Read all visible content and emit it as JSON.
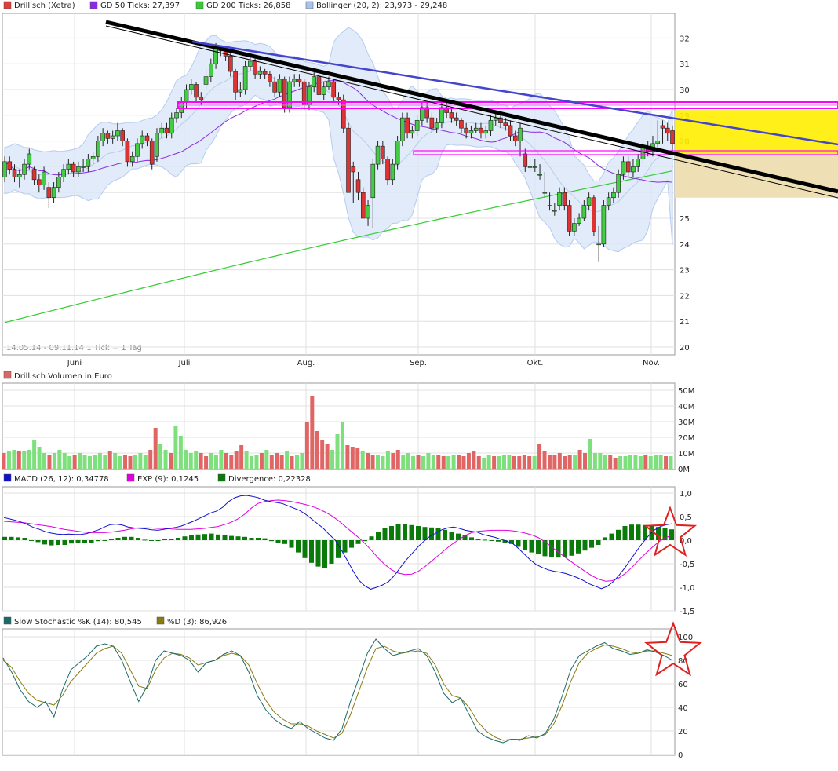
{
  "legend_top": [
    {
      "label": "Drillisch (Xetra)",
      "color": "#e03c3c"
    },
    {
      "label": "GD 50 Ticks: 27,397",
      "color": "#8a2be2"
    },
    {
      "label": "GD 200 Ticks: 26,858",
      "color": "#33cc33"
    },
    {
      "label": "Bollinger (20, 2): 23,973 - 29,248",
      "color": "#a8c4ee"
    }
  ],
  "legend_volume": {
    "label": "Drillisch Volumen in Euro",
    "color": "#e06666"
  },
  "legend_macd": [
    {
      "label": "MACD (26, 12): 0,34778",
      "color": "#1010cc"
    },
    {
      "label": "EXP (9): 0,1245",
      "color": "#e000e0"
    },
    {
      "label": "Divergence: 0,22328",
      "color": "#0a7a0a"
    }
  ],
  "legend_stoch": [
    {
      "label": "Slow Stochastic %K (14): 80,545",
      "color": "#1a6a6a"
    },
    {
      "label": "%D (3): 86,926",
      "color": "#8a7a10"
    }
  ],
  "period_note": "14.05.14 - 09.11.14   1 Tick = 1 Tag",
  "chart_data": [
    {
      "type": "candlestick",
      "title": "Drillisch (Xetra)",
      "x_labels": [
        "Juni",
        "Juli",
        "Aug.",
        "Sep.",
        "Okt.",
        "Nov."
      ],
      "y_ticks": [
        "32",
        "31",
        "30",
        "29",
        "28",
        "27",
        "26",
        "25",
        "24",
        "23",
        "22",
        "21",
        "20"
      ],
      "ylim": [
        19.8,
        32.8
      ],
      "close": [
        27.2,
        26.9,
        26.6,
        26.7,
        27.1,
        27.5,
        26.5,
        26.3,
        26.8,
        25.8,
        26.2,
        26.6,
        26.9,
        27.1,
        26.8,
        27.0,
        27.0,
        27.3,
        27.4,
        28.0,
        28.3,
        28.1,
        28.2,
        28.4,
        28.0,
        27.2,
        27.4,
        27.9,
        28.2,
        28.0,
        27.1,
        28.3,
        28.5,
        28.3,
        28.9,
        29.1,
        29.5,
        30.0,
        30.2,
        29.7,
        29.6,
        30.5,
        31.0,
        31.6,
        31.5,
        31.3,
        30.7,
        29.9,
        30.0,
        30.9,
        31.1,
        30.6,
        30.7,
        30.6,
        30.3,
        29.9,
        30.4,
        29.3,
        30.3,
        30.4,
        30.3,
        29.4,
        30.1,
        30.5,
        29.8,
        30.1,
        30.3,
        29.7,
        29.6,
        28.5,
        26.0,
        26.8,
        26.0,
        25.0,
        25.5,
        27.1,
        27.8,
        27.3,
        26.5,
        27.1,
        28.0,
        28.9,
        28.3,
        28.4,
        28.8,
        29.3,
        28.9,
        28.5,
        28.7,
        29.3,
        29.1,
        28.9,
        28.8,
        28.5,
        28.3,
        28.4,
        28.5,
        28.3,
        28.4,
        28.8,
        28.9,
        28.7,
        28.6,
        28.2,
        28.0,
        28.5,
        27.0,
        27.0,
        27.0,
        26.7,
        26.0,
        25.5,
        25.3,
        26.0,
        25.5,
        24.5,
        24.8,
        25.0,
        25.5,
        25.8,
        24.5,
        24.0,
        25.5,
        25.8,
        26.0,
        26.7,
        27.2,
        26.8,
        27.0,
        27.3,
        27.8,
        27.6,
        27.9,
        28.0,
        28.5,
        28.3,
        27.9
      ],
      "open": [
        26.6,
        27.2,
        26.9,
        26.6,
        26.7,
        27.1,
        26.9,
        26.5,
        26.3,
        26.2,
        25.8,
        26.2,
        26.6,
        26.9,
        27.1,
        26.8,
        27.0,
        27.0,
        27.3,
        27.4,
        28.0,
        28.3,
        28.1,
        28.2,
        28.4,
        28.0,
        27.2,
        27.4,
        27.9,
        28.2,
        28.0,
        27.4,
        28.3,
        28.5,
        28.3,
        28.9,
        29.1,
        29.5,
        30.0,
        30.2,
        29.7,
        30.2,
        30.5,
        31.0,
        31.6,
        31.5,
        31.3,
        30.7,
        29.9,
        30.0,
        30.9,
        31.1,
        30.6,
        30.7,
        30.6,
        30.3,
        29.9,
        30.4,
        29.3,
        30.3,
        30.4,
        30.3,
        29.4,
        30.1,
        30.5,
        29.8,
        30.1,
        30.3,
        29.7,
        29.6,
        28.5,
        27.0,
        26.5,
        26.0,
        25.0,
        25.8,
        27.1,
        27.8,
        27.3,
        26.5,
        27.1,
        28.0,
        28.9,
        28.3,
        28.4,
        28.8,
        29.3,
        28.9,
        28.5,
        28.7,
        29.3,
        29.1,
        28.9,
        28.8,
        28.5,
        28.3,
        28.4,
        28.5,
        28.3,
        28.4,
        28.8,
        28.9,
        28.7,
        28.6,
        28.2,
        28.0,
        27.5,
        27.0,
        27.0,
        26.7,
        26.0,
        25.5,
        25.3,
        25.5,
        26.0,
        25.5,
        24.5,
        24.8,
        25.0,
        25.5,
        25.8,
        24.0,
        24.0,
        25.5,
        25.8,
        26.0,
        26.7,
        27.2,
        26.8,
        27.0,
        27.3,
        27.8,
        27.6,
        27.9,
        28.6,
        28.5,
        28.4
      ],
      "high": [
        27.4,
        27.4,
        27.1,
        26.9,
        27.3,
        27.7,
        27.0,
        26.7,
        27.0,
        26.4,
        26.4,
        26.8,
        27.1,
        27.3,
        27.2,
        27.2,
        27.3,
        27.5,
        27.6,
        28.2,
        28.5,
        28.4,
        28.4,
        28.7,
        28.5,
        28.1,
        27.6,
        28.1,
        28.4,
        28.3,
        28.1,
        28.5,
        28.7,
        28.7,
        29.1,
        29.3,
        29.7,
        30.2,
        30.4,
        30.3,
        29.9,
        30.8,
        31.2,
        31.8,
        31.7,
        31.6,
        31.4,
        30.8,
        30.3,
        31.1,
        31.3,
        31.2,
        30.9,
        30.8,
        30.7,
        30.5,
        30.6,
        30.5,
        30.5,
        30.6,
        30.6,
        30.4,
        30.3,
        30.7,
        30.6,
        30.3,
        30.5,
        30.4,
        29.9,
        29.8,
        28.7,
        27.2,
        26.8,
        26.2,
        25.7,
        27.3,
        28.0,
        28.0,
        27.4,
        27.3,
        28.2,
        29.1,
        29.1,
        28.6,
        29.0,
        29.5,
        29.5,
        29.1,
        28.9,
        29.5,
        29.5,
        29.3,
        29.1,
        28.9,
        28.7,
        28.6,
        28.7,
        28.7,
        28.6,
        29.0,
        29.1,
        29.0,
        28.9,
        28.8,
        28.4,
        28.7,
        27.7,
        27.3,
        27.3,
        27.1,
        26.8,
        26.0,
        25.6,
        26.2,
        26.2,
        25.7,
        25.0,
        25.2,
        25.7,
        26.0,
        25.9,
        24.7,
        25.7,
        26.0,
        26.2,
        26.9,
        27.4,
        27.4,
        27.3,
        27.5,
        28.0,
        28.0,
        28.2,
        28.8,
        28.8,
        28.7,
        28.6
      ],
      "low": [
        26.4,
        26.7,
        26.4,
        26.2,
        26.5,
        26.9,
        26.3,
        26.0,
        26.1,
        25.4,
        25.6,
        26.0,
        26.4,
        26.7,
        26.6,
        26.6,
        26.8,
        26.8,
        27.1,
        27.2,
        27.8,
        27.9,
        27.9,
        28.0,
        27.8,
        27.0,
        27.0,
        27.2,
        27.7,
        27.8,
        26.9,
        27.2,
        28.1,
        28.1,
        28.1,
        28.7,
        28.9,
        29.3,
        29.8,
        29.5,
        29.4,
        30.0,
        30.3,
        30.8,
        31.3,
        31.1,
        30.5,
        29.6,
        29.7,
        29.8,
        30.7,
        30.4,
        30.4,
        30.4,
        30.1,
        29.7,
        29.7,
        29.1,
        29.1,
        30.1,
        30.1,
        29.2,
        29.2,
        29.9,
        29.6,
        29.6,
        30.0,
        29.5,
        29.4,
        28.3,
        27.5,
        25.6,
        25.7,
        25.6,
        24.7,
        24.6,
        26.9,
        27.1,
        26.3,
        26.3,
        26.9,
        27.8,
        28.1,
        28.1,
        28.2,
        28.6,
        28.7,
        28.3,
        28.3,
        28.5,
        28.9,
        28.7,
        28.6,
        28.3,
        28.1,
        28.1,
        28.3,
        28.1,
        28.1,
        28.2,
        28.6,
        28.5,
        28.4,
        28.0,
        27.8,
        27.4,
        26.8,
        26.8,
        26.8,
        26.5,
        25.8,
        25.3,
        25.1,
        25.3,
        25.3,
        24.3,
        24.3,
        24.7,
        24.9,
        25.3,
        24.3,
        23.3,
        23.9,
        25.3,
        25.6,
        25.8,
        26.5,
        26.6,
        26.6,
        26.8,
        27.1,
        27.4,
        27.4,
        27.7,
        27.9,
        28.0,
        27.6
      ],
      "bollinger": {
        "upper_last": 29.248,
        "lower_last": 23.973
      }
    },
    {
      "type": "bar",
      "title": "Drillisch Volumen in Euro",
      "y_ticks": [
        "50M",
        "40M",
        "30M",
        "20M",
        "10M",
        "0M"
      ],
      "ylim": [
        0,
        50
      ],
      "values": [
        10,
        11,
        12,
        11,
        11,
        12,
        18,
        14,
        10,
        9,
        10,
        12,
        10,
        8,
        9,
        10,
        9,
        8,
        9,
        10,
        9,
        11,
        10,
        8,
        9,
        8,
        9,
        10,
        9,
        12,
        26,
        16,
        12,
        10,
        27,
        21,
        12,
        10,
        11,
        10,
        8,
        10,
        9,
        12,
        10,
        9,
        11,
        15,
        11,
        8,
        9,
        10,
        12,
        9,
        10,
        9,
        11,
        8,
        9,
        10,
        30,
        46,
        24,
        18,
        16,
        12,
        22,
        30,
        15,
        14,
        13,
        11,
        10,
        9,
        9,
        8,
        11,
        10,
        12,
        9,
        10,
        8,
        9,
        8,
        10,
        9,
        9,
        8,
        8,
        9,
        9,
        8,
        10,
        11,
        8,
        7,
        9,
        8,
        8,
        9,
        9,
        8,
        8,
        9,
        8,
        8,
        16,
        11,
        9,
        9,
        10,
        8,
        9,
        9,
        12,
        10,
        19,
        10,
        10,
        9,
        9,
        7,
        8,
        8,
        9,
        9,
        8,
        9,
        8,
        9,
        9,
        8,
        8
      ],
      "up": [
        0,
        1,
        1,
        0,
        1,
        1,
        1,
        1,
        1,
        0,
        1,
        1,
        1,
        1,
        0,
        1,
        1,
        1,
        1,
        1,
        1,
        0,
        1,
        1,
        0,
        0,
        1,
        1,
        1,
        0,
        0,
        1,
        1,
        0,
        1,
        1,
        1,
        1,
        1,
        0,
        0,
        1,
        1,
        1,
        0,
        0,
        0,
        0,
        1,
        1,
        1,
        0,
        1,
        0,
        0,
        0,
        1,
        0,
        1,
        1,
        0,
        0,
        0,
        0,
        0,
        1,
        1,
        1,
        0,
        0,
        0,
        1,
        0,
        0,
        1,
        1,
        1,
        0,
        0,
        1,
        1,
        1,
        0,
        1,
        1,
        1,
        0,
        0,
        1,
        1,
        0,
        0,
        0,
        0,
        0,
        1,
        1,
        0,
        1,
        1,
        1,
        0,
        0,
        0,
        0,
        1,
        0,
        0,
        0,
        0,
        0,
        0,
        0,
        1,
        0,
        0,
        1,
        1,
        1,
        1,
        0,
        0,
        1,
        1,
        1,
        1,
        1,
        0,
        1,
        1,
        1,
        0,
        1
      ]
    },
    {
      "type": "line",
      "title": "MACD (26, 12)",
      "y_ticks": [
        "1,0",
        "0,5",
        "0,0",
        "-0,5",
        "-1,0",
        "-1,5"
      ],
      "ylim": [
        -1.5,
        1.0
      ],
      "macd": [
        0.48,
        0.45,
        0.42,
        0.38,
        0.33,
        0.27,
        0.23,
        0.18,
        0.15,
        0.13,
        0.12,
        0.13,
        0.12,
        0.12,
        0.14,
        0.18,
        0.22,
        0.28,
        0.33,
        0.34,
        0.32,
        0.28,
        0.26,
        0.25,
        0.24,
        0.22,
        0.21,
        0.23,
        0.25,
        0.27,
        0.3,
        0.35,
        0.4,
        0.46,
        0.52,
        0.58,
        0.62,
        0.7,
        0.82,
        0.9,
        0.94,
        0.95,
        0.93,
        0.9,
        0.85,
        0.82,
        0.8,
        0.78,
        0.73,
        0.68,
        0.63,
        0.55,
        0.45,
        0.35,
        0.25,
        0.12,
        0.0,
        -0.2,
        -0.42,
        -0.65,
        -0.85,
        -0.97,
        -1.04,
        -1.0,
        -0.95,
        -0.88,
        -0.75,
        -0.58,
        -0.42,
        -0.28,
        -0.14,
        -0.02,
        0.08,
        0.15,
        0.22,
        0.26,
        0.28,
        0.25,
        0.21,
        0.19,
        0.17,
        0.12,
        0.09,
        0.06,
        0.02,
        -0.02,
        -0.07,
        -0.18,
        -0.3,
        -0.42,
        -0.52,
        -0.58,
        -0.63,
        -0.66,
        -0.68,
        -0.71,
        -0.75,
        -0.8,
        -0.86,
        -0.93,
        -0.98,
        -1.03,
        -0.98,
        -0.88,
        -0.74,
        -0.58,
        -0.4,
        -0.22,
        -0.05,
        0.1,
        0.22,
        0.29,
        0.33,
        0.35
      ],
      "signal": [
        0.4,
        0.39,
        0.38,
        0.37,
        0.35,
        0.33,
        0.31,
        0.29,
        0.26,
        0.23,
        0.21,
        0.19,
        0.17,
        0.16,
        0.16,
        0.16,
        0.17,
        0.19,
        0.21,
        0.24,
        0.26,
        0.26,
        0.26,
        0.25,
        0.25,
        0.24,
        0.23,
        0.23,
        0.23,
        0.24,
        0.25,
        0.27,
        0.29,
        0.33,
        0.38,
        0.45,
        0.55,
        0.68,
        0.78,
        0.82,
        0.84,
        0.85,
        0.84,
        0.82,
        0.79,
        0.76,
        0.72,
        0.67,
        0.6,
        0.52,
        0.42,
        0.3,
        0.18,
        0.06,
        -0.07,
        -0.22,
        -0.38,
        -0.52,
        -0.63,
        -0.7,
        -0.73,
        -0.72,
        -0.66,
        -0.56,
        -0.44,
        -0.32,
        -0.2,
        -0.09,
        0.01,
        0.1,
        0.16,
        0.19,
        0.2,
        0.21,
        0.21,
        0.21,
        0.2,
        0.18,
        0.15,
        0.11,
        0.05,
        -0.04,
        -0.15,
        -0.26,
        -0.37,
        -0.47,
        -0.57,
        -0.67,
        -0.76,
        -0.83,
        -0.87,
        -0.86,
        -0.8,
        -0.7,
        -0.57,
        -0.42,
        -0.28,
        -0.15,
        -0.03,
        0.05,
        0.12
      ],
      "divergence": [
        0.07,
        0.07,
        0.06,
        0.05,
        0.0,
        -0.04,
        -0.09,
        -0.11,
        -0.1,
        -0.1,
        -0.07,
        -0.06,
        -0.06,
        -0.05,
        -0.02,
        0.0,
        0.02,
        0.05,
        0.07,
        0.07,
        0.05,
        0.01,
        -0.01,
        0.0,
        0.02,
        0.03,
        0.05,
        0.08,
        0.1,
        0.12,
        0.13,
        0.14,
        0.12,
        0.1,
        0.09,
        0.08,
        0.07,
        0.05,
        0.05,
        0.04,
        -0.02,
        -0.05,
        -0.08,
        -0.16,
        -0.26,
        -0.38,
        -0.48,
        -0.56,
        -0.6,
        -0.5,
        -0.38,
        -0.26,
        -0.16,
        -0.08,
        -0.02,
        0.08,
        0.18,
        0.26,
        0.3,
        0.34,
        0.34,
        0.32,
        0.3,
        0.28,
        0.27,
        0.25,
        0.22,
        0.18,
        0.14,
        0.1,
        0.06,
        0.03,
        0.01,
        0.0,
        -0.03,
        -0.05,
        -0.08,
        -0.14,
        -0.2,
        -0.26,
        -0.3,
        -0.34,
        -0.36,
        -0.37,
        -0.36,
        -0.33,
        -0.28,
        -0.22,
        -0.16,
        -0.1,
        0.06,
        0.14,
        0.22,
        0.3,
        0.33,
        0.33,
        0.32,
        0.3,
        0.28,
        0.26,
        0.23
      ]
    },
    {
      "type": "line",
      "title": "Slow Stochastic %K (14)",
      "y_ticks": [
        "100",
        "80",
        "60",
        "40",
        "20",
        "0"
      ],
      "ylim": [
        0,
        100
      ],
      "k": [
        82,
        70,
        55,
        45,
        40,
        45,
        32,
        55,
        72,
        78,
        84,
        92,
        94,
        92,
        80,
        62,
        45,
        58,
        80,
        88,
        86,
        84,
        80,
        70,
        78,
        80,
        85,
        88,
        84,
        70,
        50,
        38,
        30,
        25,
        22,
        28,
        22,
        18,
        14,
        12,
        22,
        45,
        65,
        86,
        98,
        90,
        84,
        86,
        88,
        90,
        84,
        70,
        52,
        44,
        48,
        34,
        20,
        15,
        12,
        10,
        13,
        12,
        16,
        14,
        18,
        30,
        50,
        72,
        84,
        88,
        92,
        95,
        90,
        88,
        85,
        86,
        89,
        87,
        84,
        80
      ],
      "d": [
        80,
        74,
        62,
        52,
        46,
        44,
        42,
        50,
        62,
        70,
        78,
        86,
        90,
        92,
        86,
        72,
        58,
        56,
        72,
        82,
        86,
        85,
        82,
        76,
        78,
        80,
        84,
        86,
        84,
        76,
        60,
        46,
        36,
        30,
        26,
        26,
        24,
        20,
        17,
        14,
        18,
        34,
        54,
        74,
        90,
        92,
        88,
        86,
        87,
        88,
        86,
        76,
        60,
        50,
        48,
        40,
        28,
        20,
        15,
        12,
        13,
        13,
        14,
        15,
        17,
        26,
        42,
        62,
        78,
        86,
        90,
        93,
        92,
        90,
        87,
        86,
        88,
        88,
        86,
        84
      ]
    }
  ]
}
